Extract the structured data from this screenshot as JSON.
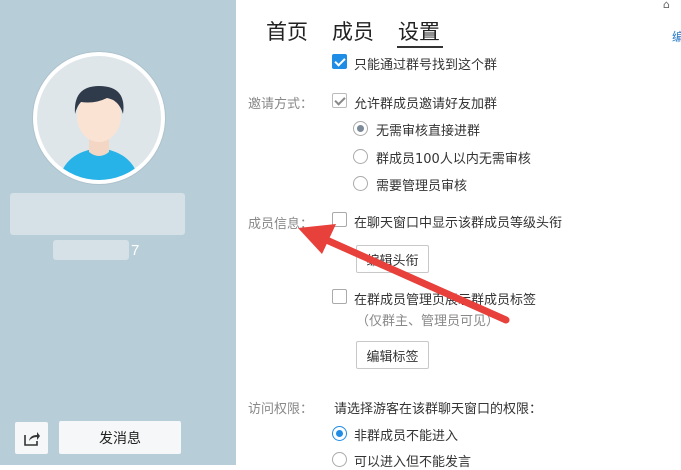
{
  "profile": {
    "member_count_suffix": "7",
    "send_message_label": "发消息",
    "share_icon": "share-icon"
  },
  "tabs": [
    {
      "label": "首页"
    },
    {
      "label": "成员"
    },
    {
      "label": "设置",
      "active": true
    }
  ],
  "settings": {
    "search_option": {
      "label": "只能通过群号找到这个群",
      "checked": true
    },
    "invite": {
      "section_label": "邀请方式：",
      "allow_label": "允许群成员邀请好友加群",
      "allow_checked": true,
      "options": [
        {
          "label": "无需审核直接进群",
          "selected": true
        },
        {
          "label": "群成员100人以内无需审核",
          "selected": false
        },
        {
          "label": "需要管理员审核",
          "selected": false
        }
      ]
    },
    "member_info": {
      "section_label": "成员信息：",
      "show_title_label": "在聊天窗口中显示该群成员等级头衔",
      "show_title_checked": false,
      "edit_title_button": "编辑头衔",
      "show_tags_label": "在群成员管理页展示群成员标签",
      "show_tags_checked": false,
      "show_tags_note": "（仅群主、管理员可见）",
      "edit_tags_button": "编辑标签"
    },
    "access": {
      "section_label": "访问权限：",
      "prompt": "请选择游客在该群聊天窗口的权限：",
      "options": [
        {
          "label": "非群成员不能进入",
          "selected": true
        },
        {
          "label": "可以进入但不能发言",
          "selected": false
        }
      ]
    }
  },
  "colors": {
    "accent": "#1f8ce6",
    "panel": "#b7cdd8",
    "arrow": "#e8403a"
  }
}
